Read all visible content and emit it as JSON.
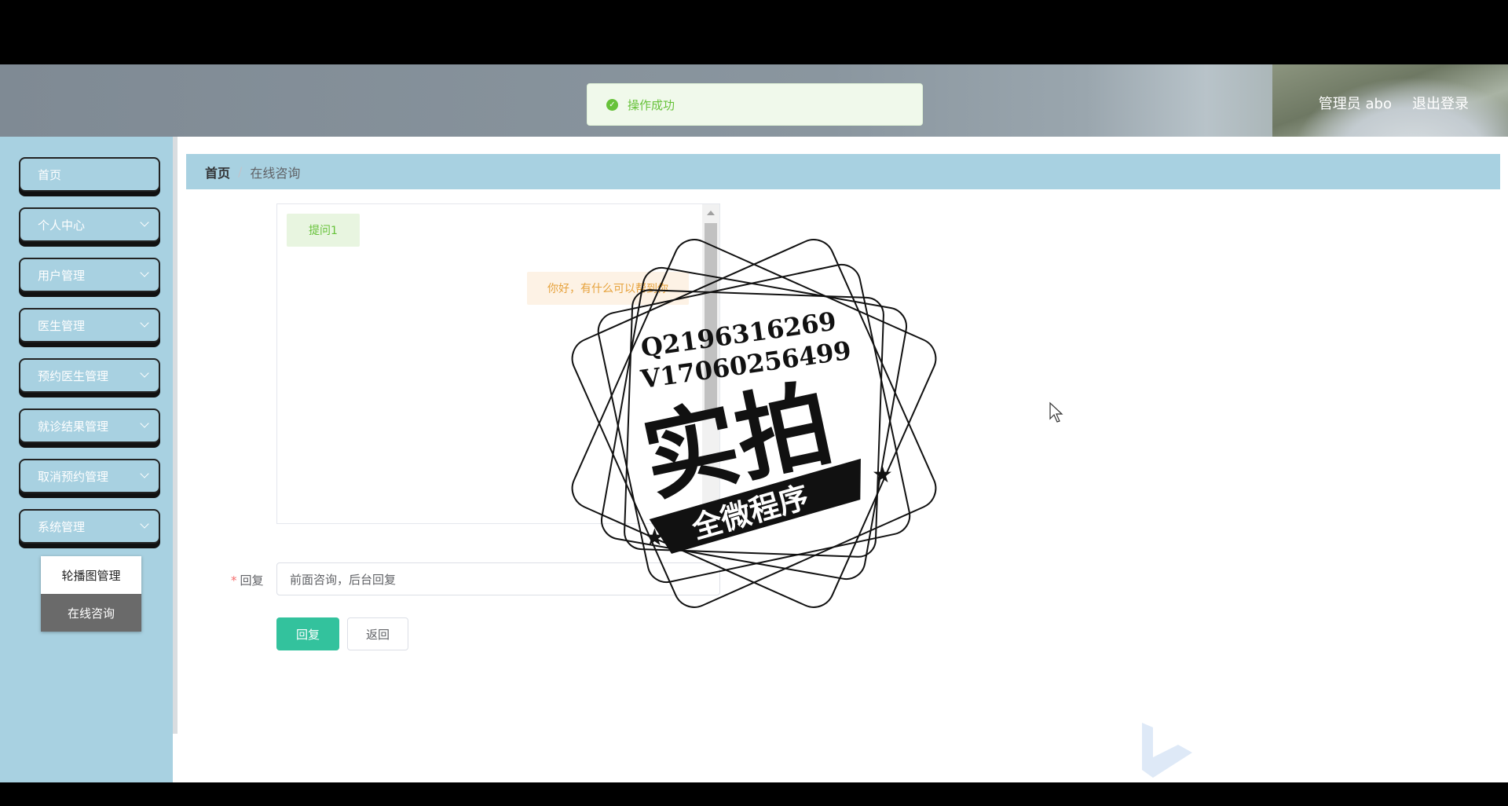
{
  "toast": {
    "message": "操作成功",
    "icon": "check-circle-icon"
  },
  "header": {
    "user_label": "管理员 abo",
    "logout_label": "退出登录"
  },
  "sidebar": {
    "items": [
      {
        "label": "首页"
      },
      {
        "label": "个人中心"
      },
      {
        "label": "用户管理"
      },
      {
        "label": "医生管理"
      },
      {
        "label": "预约医生管理"
      },
      {
        "label": "就诊结果管理"
      },
      {
        "label": "取消预约管理"
      },
      {
        "label": "系统管理"
      }
    ],
    "submenu": [
      {
        "label": "轮播图管理"
      },
      {
        "label": "在线咨询"
      }
    ]
  },
  "breadcrumb": {
    "home": "首页",
    "current": "在线咨询"
  },
  "chat": {
    "question": "提问1",
    "answer": "你好，有什么可以帮到你"
  },
  "form": {
    "reply_label": "回复",
    "reply_value": "前面咨询，后台回复",
    "submit_label": "回复",
    "back_label": "返回"
  },
  "watermark": {
    "qq": "Q2196316269",
    "wechat": "V17060256499",
    "main_text": "实拍",
    "banner_text": "全微程序"
  },
  "colors": {
    "sidebar_bg": "#a8d1e1",
    "primary_button": "#33c29d",
    "success": "#67c23a"
  }
}
